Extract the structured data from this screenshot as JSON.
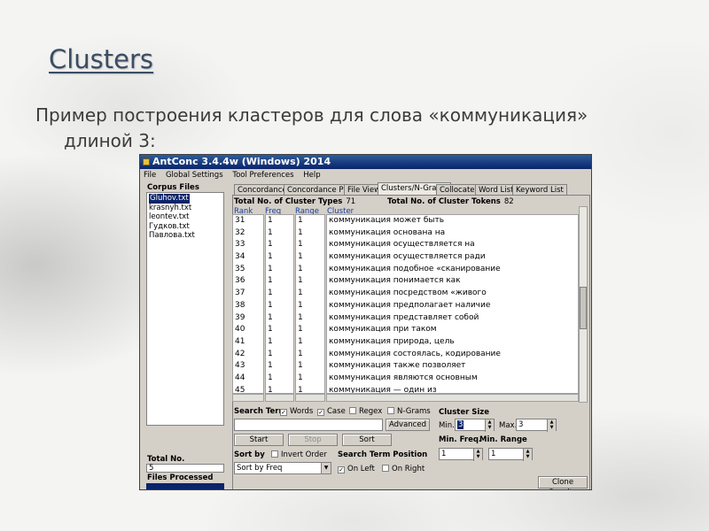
{
  "slide": {
    "title": "Clusters",
    "line1": "Пример построения кластеров для слова «коммуникация»",
    "line2": "длиной 3:"
  },
  "window": {
    "title": "AntConc 3.4.4w (Windows) 2014",
    "menu": [
      "File",
      "Global Settings",
      "Tool Preferences",
      "Help"
    ]
  },
  "corpus": {
    "label": "Corpus Files",
    "files": [
      "Gluhov.txt",
      "krasnyh.txt",
      "leontev.txt",
      "Гудков.txt",
      "Павлова.txt"
    ],
    "total_label": "Total No.",
    "total_value": "5",
    "processed_label": "Files Processed"
  },
  "tabs": [
    "Concordance",
    "Concordance Plot",
    "File View",
    "Clusters/N-Grams",
    "Collocates",
    "Word List",
    "Keyword List"
  ],
  "stats": {
    "types_label": "Total No. of Cluster Types",
    "types_value": "71",
    "tokens_label": "Total No. of Cluster Tokens",
    "tokens_value": "82"
  },
  "columns": {
    "rank": "Rank",
    "freq": "Freq",
    "range": "Range",
    "cluster": "Cluster"
  },
  "rows": [
    {
      "rank": "31",
      "freq": "1",
      "range": "1",
      "cluster": "коммуникация может быть"
    },
    {
      "rank": "32",
      "freq": "1",
      "range": "1",
      "cluster": "коммуникация основана на"
    },
    {
      "rank": "33",
      "freq": "1",
      "range": "1",
      "cluster": "коммуникация осуществляется на"
    },
    {
      "rank": "34",
      "freq": "1",
      "range": "1",
      "cluster": "коммуникация осуществляется ради"
    },
    {
      "rank": "35",
      "freq": "1",
      "range": "1",
      "cluster": "коммуникация подобное «сканирование"
    },
    {
      "rank": "36",
      "freq": "1",
      "range": "1",
      "cluster": "коммуникация понимается как"
    },
    {
      "rank": "37",
      "freq": "1",
      "range": "1",
      "cluster": "коммуникация посредством «живого"
    },
    {
      "rank": "38",
      "freq": "1",
      "range": "1",
      "cluster": "коммуникация предполагает наличие"
    },
    {
      "rank": "39",
      "freq": "1",
      "range": "1",
      "cluster": "коммуникация представляет собой"
    },
    {
      "rank": "40",
      "freq": "1",
      "range": "1",
      "cluster": "коммуникация при таком"
    },
    {
      "rank": "41",
      "freq": "1",
      "range": "1",
      "cluster": "коммуникация природа, цель"
    },
    {
      "rank": "42",
      "freq": "1",
      "range": "1",
      "cluster": "коммуникация состоялась, кодирование"
    },
    {
      "rank": "43",
      "freq": "1",
      "range": "1",
      "cluster": "коммуникация также позволяет"
    },
    {
      "rank": "44",
      "freq": "1",
      "range": "1",
      "cluster": "коммуникация являются основным"
    },
    {
      "rank": "45",
      "freq": "1",
      "range": "1",
      "cluster": "коммуникация — один из"
    }
  ],
  "search": {
    "label": "Search Term",
    "words": "Words",
    "case": "Case",
    "regex": "Regex",
    "ngrams": "N-Grams",
    "advanced": "Advanced",
    "start": "Start",
    "stop": "Stop",
    "sort": "Sort"
  },
  "cluster_size": {
    "label": "Cluster Size",
    "min_label": "Min.",
    "min_value": "3",
    "max_label": "Max.",
    "max_value": "3"
  },
  "sort": {
    "label": "Sort by",
    "invert": "Invert Order",
    "selected": "Sort by Freq"
  },
  "position": {
    "label": "Search Term Position",
    "left": "On Left",
    "right": "On Right"
  },
  "minfreq": {
    "label": "Min. Freq.",
    "value": "1"
  },
  "minrange": {
    "label": "Min. Range",
    "value": "1"
  },
  "clone": "Clone Results"
}
